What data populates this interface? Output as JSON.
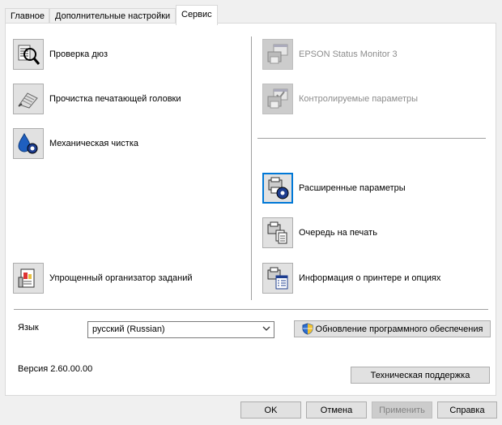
{
  "tabs": [
    {
      "label": "Главное"
    },
    {
      "label": "Дополнительные настройки"
    },
    {
      "label": "Сервис"
    }
  ],
  "left_tools": [
    {
      "label": "Проверка дюз",
      "icon": "nozzle-check-icon"
    },
    {
      "label": "Прочистка печатающей головки",
      "icon": "head-cleaning-icon"
    },
    {
      "label": "Механическая чистка",
      "icon": "power-cleaning-icon"
    },
    {
      "label": "Упрощенный организатор заданий",
      "icon": "job-arranger-icon"
    }
  ],
  "right_tools": [
    {
      "label": "EPSON Status Monitor 3",
      "icon": "status-monitor-icon",
      "disabled": true
    },
    {
      "label": "Контролируемые параметры",
      "icon": "monitoring-preferences-icon",
      "disabled": true
    },
    {
      "label": "Расширенные параметры",
      "icon": "extended-settings-icon",
      "disabled": false
    },
    {
      "label": "Очередь на печать",
      "icon": "print-queue-icon",
      "disabled": false
    },
    {
      "label": "Информация о принтере и опциях",
      "icon": "printer-info-icon",
      "disabled": false
    }
  ],
  "language": {
    "label": "Язык",
    "value": "русский (Russian)"
  },
  "update_button": "Обновление программного обеспечения",
  "version": "Версия 2.60.00.00",
  "support_button": "Техническая поддержка",
  "footer": {
    "ok": "OK",
    "cancel": "Отмена",
    "apply": "Применить",
    "help": "Справка"
  },
  "colors": {
    "accent": "#0078d7",
    "disabled_text": "#8c8c8c"
  }
}
